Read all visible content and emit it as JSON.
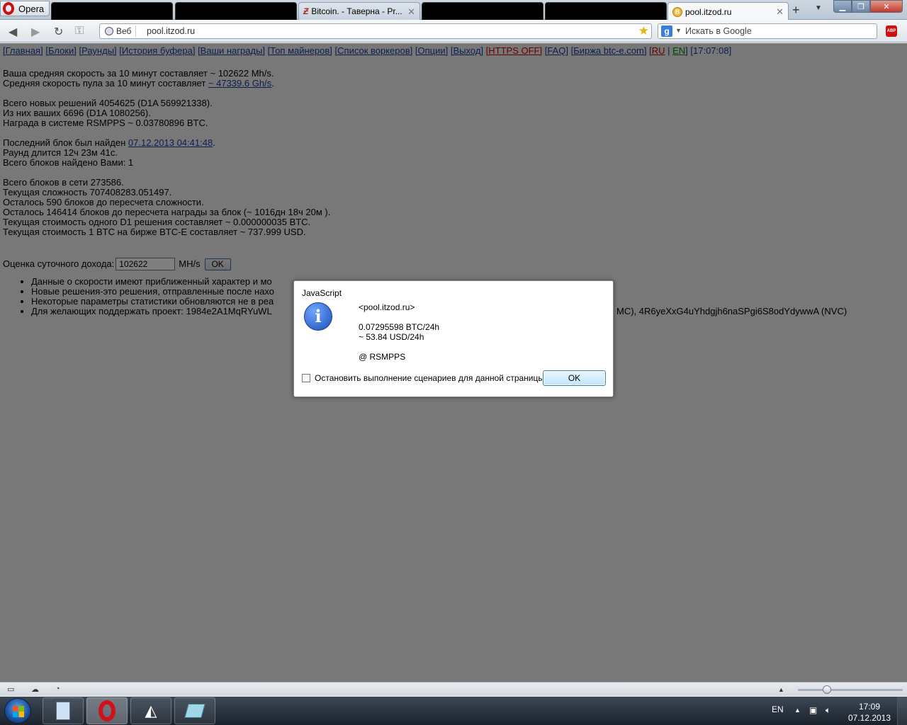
{
  "browser": {
    "menu_label": "Opera",
    "tabs": [
      {
        "label": "",
        "redacted": true
      },
      {
        "label": "",
        "redacted": true
      },
      {
        "label": "Bitcoin. - Таверна - Pr..."
      },
      {
        "label": "",
        "redacted": true
      },
      {
        "label": "",
        "redacted": true
      },
      {
        "label": "pool.itzod.ru",
        "active": true
      }
    ],
    "address": {
      "badge": "Веб",
      "url": "pool.itzod.ru"
    },
    "search": {
      "placeholder": "Искать в Google"
    }
  },
  "page": {
    "nav": {
      "main": "[Главная]",
      "blocks": "[Блоки]",
      "rounds": "[Раунды]",
      "buffer": "[История буфера]",
      "rewards": "[Ваши награды]",
      "top": "[Топ майнеров]",
      "workers": "[Список воркеров]",
      "options": "[Опции]",
      "logout": "[Выход]",
      "https": "[HTTPS OFF]",
      "faq": "[FAQ]",
      "exchange": "[Биржа btc-e.com]",
      "lang_open": "[",
      "lang_ru": "RU",
      "lang_sep": " | ",
      "lang_en": "EN",
      "lang_close": "]",
      "time": "[17:07:08]"
    },
    "speed": {
      "line1": "Ваша средняя скорость за 10 минут составляет ~ 102622 Mh/s.",
      "line2_prefix": "Средняя скорость пула за 10 минут составляет ",
      "line2_link": "~ 47339.6 Gh/s",
      "line2_suffix": "."
    },
    "shares": {
      "line1": "Всего новых решений 4054625 (D1A 569921338).",
      "line2": "Из них ваших 6696 (D1A 1080256).",
      "line3": "Награда в системе RSMPPS ~ 0.03780896 BTC."
    },
    "last_block": {
      "line1_prefix": "Последний блок был найден ",
      "line1_link": "07.12.2013 04:41:48",
      "line1_suffix": ".",
      "line2": "Раунд длится 12ч 23м 41с.",
      "line3": "Всего блоков найдено Вами: 1"
    },
    "network": {
      "line1": "Всего блоков в сети 273586.",
      "line2": "Текущая сложность 707408283.051497.",
      "line3": "Осталось 590 блоков до пересчета сложности.",
      "line4": "Осталось 146414 блоков до пересчета награды за блок (~ 1016дн 18ч 20м ).",
      "line5": "Текущая стоимость одного D1 решения составляет ~ 0.000000035 BTC.",
      "line6": "Текущая стоимость 1 BTC на бирже BTC-E составляет ~ 737.999 USD."
    },
    "estimate": {
      "label": "Оценка суточного дохода:",
      "value": "102622",
      "unit": "MH/s",
      "button": "OK"
    },
    "notes": [
      "Данные о скорости имеют приближенный характер и мо",
      "Новые решения-это решения, отправленные после нахо",
      "Некоторые параметры статистики обновляются не в реа",
      "Для желающих поддержать проект: 1984e2A1MqRYuWL"
    ],
    "donate_tail": "MC), 4R6yeXxG4uYhdgjh6naSPgi6S8odYdywwA (NVC)"
  },
  "dialog": {
    "title": "JavaScript",
    "icon": "info-icon",
    "lines": [
      "<pool.itzod.ru>",
      "",
      "0.07295598 BTC/24h",
      "~ 53.84 USD/24h",
      "",
      "@ RSMPPS"
    ],
    "checkbox_label": "Остановить выполнение сценариев для данной страницы",
    "ok": "OK"
  },
  "taskbar": {
    "lang": "EN",
    "time": "17:09",
    "date": "07.12.2013"
  }
}
